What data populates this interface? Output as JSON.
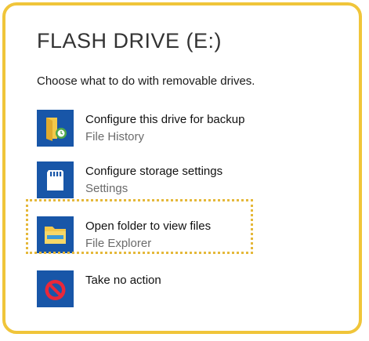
{
  "dialog": {
    "title": "FLASH DRIVE (E:)",
    "subtitle": "Choose what to do with removable drives."
  },
  "options": [
    {
      "label": "Configure this drive for backup",
      "sub": "File History",
      "icon": "file-history-icon"
    },
    {
      "label": "Configure storage settings",
      "sub": "Settings",
      "icon": "sd-card-icon"
    },
    {
      "label": "Open folder to view files",
      "sub": "File Explorer",
      "icon": "folder-icon"
    },
    {
      "label": "Take no action",
      "sub": "",
      "icon": "no-action-icon"
    }
  ],
  "colors": {
    "frame_border": "#f0c53a",
    "highlight_dots": "#e5b83a",
    "icon_tile": "#1856a8"
  }
}
